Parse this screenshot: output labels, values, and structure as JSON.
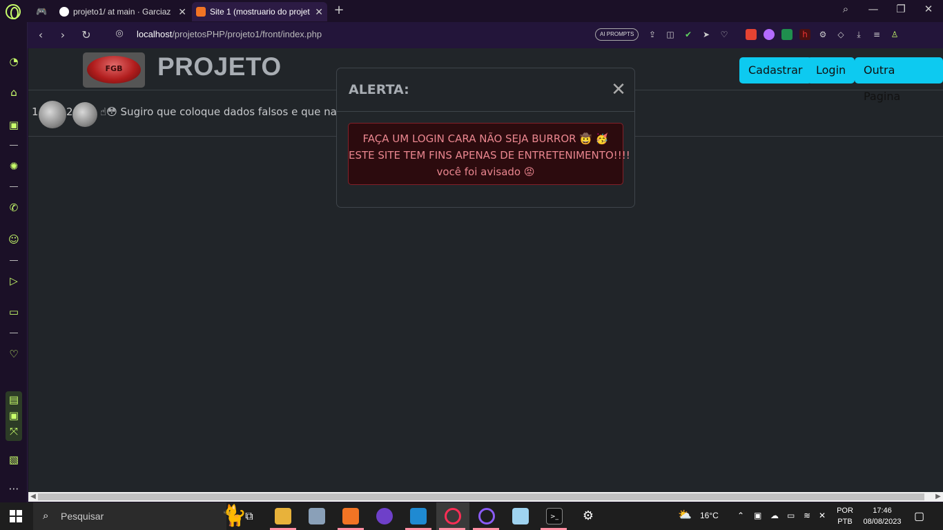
{
  "browser": {
    "tabs": [
      {
        "label": "projeto1/ at main · Garciaz",
        "active": false
      },
      {
        "label": "Site 1 (mostruario do projet",
        "active": true
      }
    ],
    "url_host": "localhost",
    "url_path": "/projetosPHP/projeto1/front/index.php",
    "ai_prompts_label": "AI PROMPTS"
  },
  "page": {
    "logo_text": "FGB",
    "brand": "PROJETO",
    "nav_buttons": {
      "register": "Cadastrar",
      "login": "Login",
      "other": "Outra Pagina"
    },
    "row": {
      "index_1": "1",
      "index_2": "2",
      "comment": "☝😳 Sugiro que coloque dados falsos e que na h"
    },
    "modal": {
      "title": "ALERTA:",
      "close": "✕",
      "alert_lines": [
        "FAÇA UM LOGIN CARA NÃO SEJA BURROR 🤠 🥳",
        "ESTE SITE TEM FINS APENAS DE ENTRETENIMENTO!!!!",
        "você foi avisado 😡"
      ]
    }
  },
  "taskbar": {
    "search_placeholder": "Pesquisar",
    "weather": "16°C",
    "language": "POR",
    "keyboard": "PTB",
    "time": "17:46",
    "date": "08/08/2023"
  },
  "colors": {
    "accent": "#c9ff6b",
    "button": "#0dcaf0",
    "page_bg": "#212529",
    "alert_bg": "#2c0b0e",
    "alert_text": "#ea868f"
  }
}
